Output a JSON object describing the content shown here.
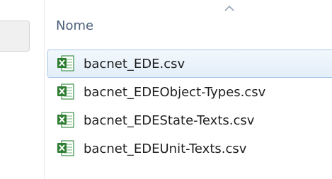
{
  "header": {
    "column_name_label": "Nome"
  },
  "files": [
    {
      "name": "bacnet_EDE.csv",
      "icon": "excel-csv-icon",
      "selected": true
    },
    {
      "name": "bacnet_EDEObject-Types.csv",
      "icon": "excel-csv-icon",
      "selected": false
    },
    {
      "name": "bacnet_EDEState-Texts.csv",
      "icon": "excel-csv-icon",
      "selected": false
    },
    {
      "name": "bacnet_EDEUnit-Texts.csv",
      "icon": "excel-csv-icon",
      "selected": false
    }
  ],
  "colors": {
    "header_text": "#4c607a",
    "selection_border": "#a7c8ea",
    "excel_green": "#2e7d32"
  }
}
